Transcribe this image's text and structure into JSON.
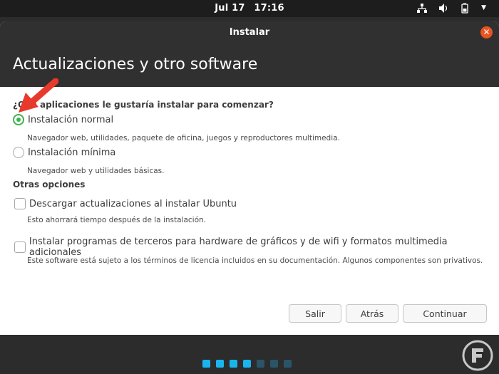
{
  "topbar": {
    "date": "Jul 17",
    "time": "17:16"
  },
  "window": {
    "title": "Instalar",
    "heading": "Actualizaciones y otro software"
  },
  "content": {
    "question": "¿Qué aplicaciones le gustaría instalar para comenzar?",
    "normal": {
      "label": "Instalación normal",
      "description": "Navegador web, utilidades, paquete de oficina, juegos y reproductores multimedia.",
      "selected": true
    },
    "minimal": {
      "label": "Instalación mínima",
      "description": "Navegador web y utilidades básicas.",
      "selected": false
    },
    "other_options_title": "Otras opciones",
    "download_updates": {
      "label": "Descargar actualizaciones al instalar Ubuntu",
      "description": "Esto ahorrará tiempo después de la instalación.",
      "checked": false
    },
    "third_party": {
      "label": "Instalar programas de terceros para hardware de gráficos y de wifi y formatos multimedia adicionales",
      "description": "Este software está sujeto a los términos de licencia incluidos en su documentación. Algunos componentes son privativos.",
      "checked": false
    }
  },
  "buttons": {
    "quit": "Salir",
    "back": "Atrás",
    "continue": "Continuar"
  },
  "progress": {
    "total_steps": 7,
    "completed_steps": 4
  },
  "icons": {
    "close": "close-icon",
    "network": "network-icon",
    "volume": "volume-icon",
    "battery": "battery-icon",
    "menu": "chevron-down-icon"
  },
  "colors": {
    "accent_orange": "#e95420",
    "radio_green": "#3eb34f",
    "progress_active": "#19b6ee",
    "progress_inactive": "#2a5568",
    "annotation_arrow": "#e8392d"
  }
}
